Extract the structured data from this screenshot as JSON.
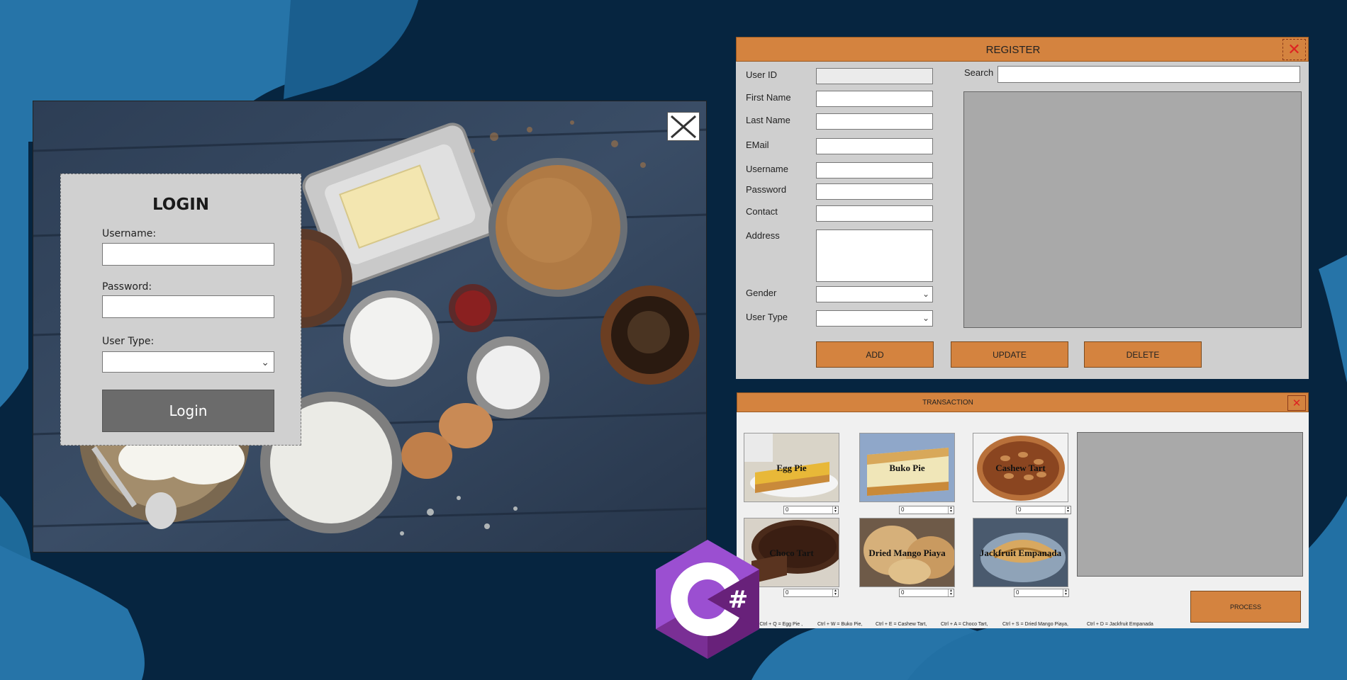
{
  "login": {
    "title": "LOGIN",
    "username_label": "Username:",
    "password_label": "Password:",
    "usertype_label": "User Type:",
    "username_value": "",
    "password_value": "",
    "usertype_value": "",
    "login_button": "Login",
    "close_icon": "close-icon"
  },
  "register": {
    "title": "REGISTER",
    "fields": {
      "user_id": "User ID",
      "first_name": "First Name",
      "last_name": "Last Name",
      "email": "EMail",
      "username": "Username",
      "password": "Password",
      "contact": "Contact",
      "address": "Address",
      "gender": "Gender",
      "user_type": "User Type"
    },
    "search_label": "Search",
    "buttons": {
      "add": "ADD",
      "update": "UPDATE",
      "delete": "DELETE"
    }
  },
  "transaction": {
    "title": "TRANSACTION",
    "items": [
      {
        "name": "Egg Pie",
        "qty": "0"
      },
      {
        "name": "Buko Pie",
        "qty": "0"
      },
      {
        "name": "Cashew Tart",
        "qty": "0"
      },
      {
        "name": "Choco Tart",
        "qty": "0"
      },
      {
        "name": "Dried Mango Piaya",
        "qty": "0"
      },
      {
        "name": "Jackfruit Empanada",
        "qty": "0"
      }
    ],
    "process_button": "PROCESS",
    "hints": [
      "ND · Ctrl + Q = Egg Pie ,",
      "Ctrl + W = Buko Pie,",
      "Ctrl + E = Cashew Tart,",
      "Ctrl + A = Choco Tart,",
      "Ctrl + S = Dried Mango Piaya,",
      "Ctrl + D = Jackfruit Empanada"
    ]
  },
  "colors": {
    "background": "#062540",
    "background_wave": "#1f6ea0",
    "accent_orange": "#d4833f",
    "panel_gray": "#cfcfcf",
    "grid_gray": "#a9a9a9",
    "csharp_purple": "#68217a"
  },
  "logo": {
    "text": "C#"
  }
}
